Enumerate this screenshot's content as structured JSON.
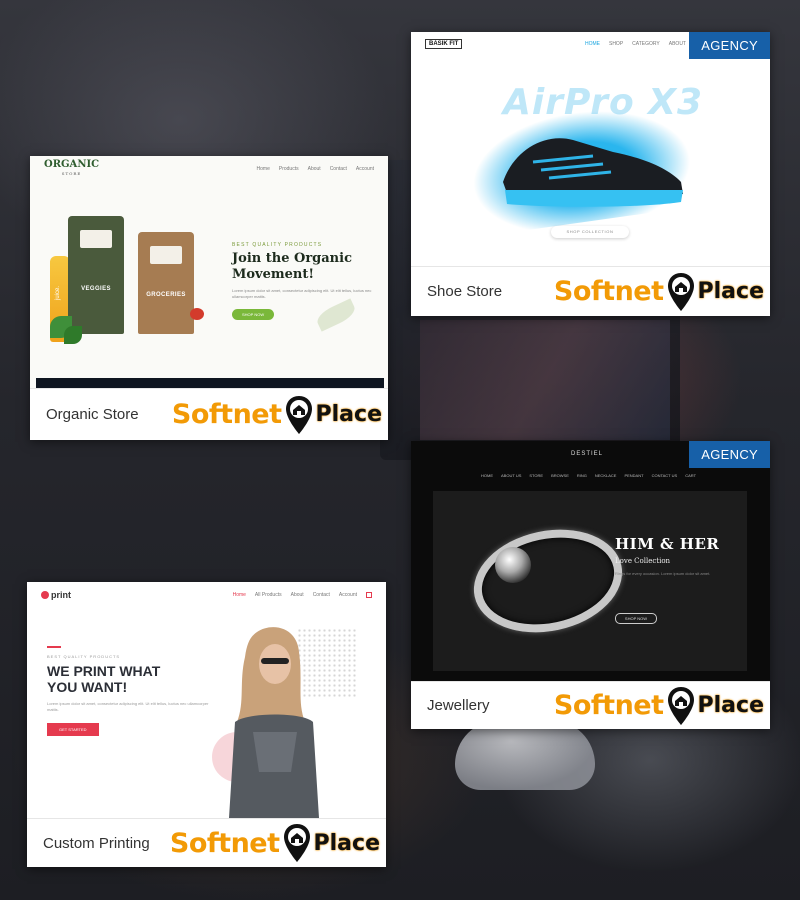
{
  "cards": {
    "organic": {
      "caption": "Organic Store",
      "site": {
        "logo": "ORGANIC",
        "logo_sub": "STORE",
        "nav": [
          "Home",
          "Products",
          "About",
          "Contact",
          "Account"
        ],
        "kicker": "BEST QUALITY PRODUCTS",
        "title_line1": "Join the Organic",
        "title_line2": "Movement!",
        "body": "Lorem ipsum dolor sit amet, consectetur adipiscing elit. Ut elit tellus, luctus nec ullamcorper mattis.",
        "button": "SHOP NOW",
        "pouch1": "VEGGIES",
        "pouch2": "GROCERIES",
        "bottle": "juice."
      }
    },
    "shoe": {
      "caption": "Shoe Store",
      "ribbon": "AGENCY",
      "site": {
        "logo": "BASIK FIT",
        "nav": [
          "HOME",
          "SHOP",
          "CATEGORY",
          "ABOUT"
        ],
        "hero_word": "AirPro X3",
        "button": "SHOP COLLECTION"
      }
    },
    "jewel": {
      "caption": "Jewellery",
      "ribbon": "AGENCY",
      "site": {
        "logo": "DESTIEL",
        "nav": [
          "HOME",
          "ABOUT US",
          "STORE",
          "BROWSE",
          "RING",
          "NECKLACE",
          "PENDANT",
          "CONTACT US",
          "CART"
        ],
        "title": "HIM & HER",
        "subtitle": "Love Collection",
        "body": "Rings for every occasion. Lorem ipsum dolor sit amet.",
        "button": "SHOP NOW"
      }
    },
    "print": {
      "caption": "Custom Printing",
      "site": {
        "logo": "print",
        "nav": [
          "Home",
          "All Products",
          "About",
          "Contact",
          "Account"
        ],
        "kicker": "BEST QUALITY PRODUCTS",
        "title_line1": "WE PRINT WHAT",
        "title_line2": "YOU WANT!",
        "body": "Lorem ipsum dolor sit amet, consectetur adipiscing elit. Ut elit tellus, luctus nec ullamcorper mattis.",
        "button": "GET STARTED"
      }
    }
  },
  "brand": {
    "word1": "Softnet",
    "word2": "Place",
    "accent": "#f29a06"
  },
  "colors": {
    "ribbon": "#1760a8",
    "print_accent": "#e53a4e",
    "organic_green": "#7ab83a"
  }
}
